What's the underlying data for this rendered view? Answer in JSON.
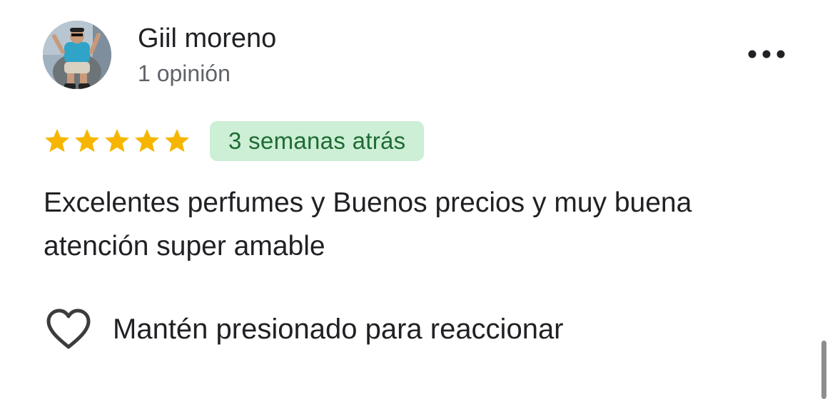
{
  "review": {
    "author": {
      "name": "Giil moreno",
      "meta": "1 opinión"
    },
    "more_icon": "more-horizontal-icon",
    "rating": 5,
    "rating_max": 5,
    "date": "3 semanas atrás",
    "text": "Excelentes perfumes y Buenos precios y muy buena atención super amable",
    "reaction": {
      "icon": "heart-outline-icon",
      "label": "Mantén presionado para reaccionar"
    }
  },
  "colors": {
    "star": "#F6B600",
    "badge_bg": "#CDEFD5",
    "badge_text": "#1E6B34",
    "text_primary": "#202124",
    "text_secondary": "#5F6368"
  }
}
